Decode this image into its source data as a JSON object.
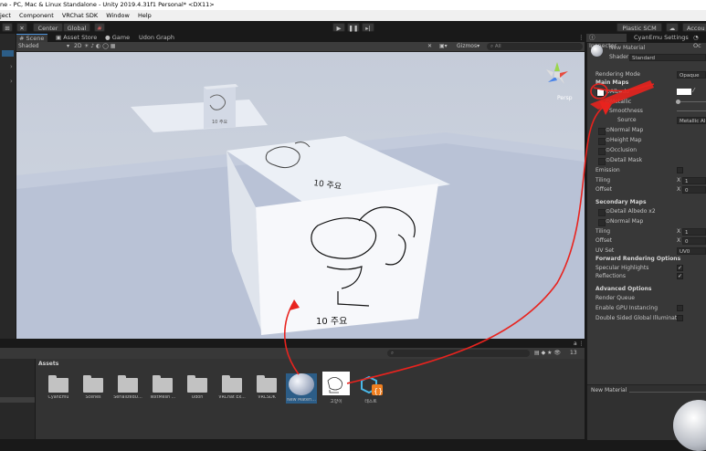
{
  "window": {
    "title": "ne - PC, Mac & Linux Standalone - Unity 2019.4.31f1 Personal* <DX11>"
  },
  "menu": [
    "ject",
    "Component",
    "VRChat SDK",
    "Window",
    "Help"
  ],
  "toolbar": {
    "center_label": "Center",
    "global_label": "Global",
    "plastic_label": "Plastic SCM",
    "account_label": "Accou"
  },
  "scene_tabs": [
    {
      "label": "Scene"
    },
    {
      "label": "Asset Store"
    },
    {
      "label": "Game"
    },
    {
      "label": "Udon Graph"
    }
  ],
  "scene_toolbar": {
    "shading_mode": "Shaded",
    "mode_2d": "2D",
    "gizmos_label": "Gizmos",
    "search_placeholder": "All",
    "persp_label": "Persp"
  },
  "viewport": {
    "small_text": "10 주요",
    "board_text": "10 주요",
    "front_text": "10 주요"
  },
  "project": {
    "assets_label": "Assets",
    "count_label": "13",
    "items": [
      {
        "label": "CyanEmu",
        "icon": "folder-icon"
      },
      {
        "label": "Scenes",
        "icon": "folder-icon"
      },
      {
        "label": "SerializedU...",
        "icon": "folder-icon"
      },
      {
        "label": "TextMesh ...",
        "icon": "folder-icon"
      },
      {
        "label": "Udon",
        "icon": "folder-icon"
      },
      {
        "label": "VRChat Ex...",
        "icon": "folder-icon"
      },
      {
        "label": "VRCSDK",
        "icon": "folder-icon"
      },
      {
        "label": "New Materi...",
        "icon": "material-sphere-icon"
      },
      {
        "label": "고양이",
        "icon": "texture-thumbnail-icon"
      },
      {
        "label": "테스트",
        "icon": "udon-script-icon"
      }
    ]
  },
  "inspector": {
    "tabs": [
      {
        "label": "Inspector"
      },
      {
        "label": "CyanEmu Settings"
      },
      {
        "label": "Oc"
      }
    ],
    "material_name": "New Material",
    "shader_label": "Shader",
    "shader_value": "Standard",
    "rendering_mode_label": "Rendering Mode",
    "rendering_mode_value": "Opaque",
    "main_maps_header": "Main Maps",
    "albedo_label": "Albedo",
    "metallic_label": "Metallic",
    "smoothness_label": "Smoothness",
    "source_label": "Source",
    "source_value": "Metallic Al",
    "normal_map_label": "Normal Map",
    "height_map_label": "Height Map",
    "occlusion_label": "Occlusion",
    "detail_mask_label": "Detail Mask",
    "emission_label": "Emission",
    "tiling_label": "Tiling",
    "offset_label": "Offset",
    "x_label": "X",
    "tiling_x": "1",
    "offset_x": "0",
    "secondary_maps_header": "Secondary Maps",
    "detail_albedo_label": "Detail Albedo x2",
    "normal_map2_label": "Normal Map",
    "tiling2_label": "Tiling",
    "offset2_label": "Offset",
    "tiling2_x": "1",
    "offset2_x": "0",
    "uv_set_label": "UV Set",
    "uv_set_value": "UV0",
    "forward_header": "Forward Rendering Options",
    "specular_label": "Specular Highlights",
    "reflections_label": "Reflections",
    "advanced_header": "Advanced Options",
    "render_queue_label": "Render Queue",
    "gpu_instancing_label": "Enable GPU Instancing",
    "double_sided_label": "Double Sided Global Illuminatio",
    "preview_label": "New Material",
    "specular_check": "✓",
    "reflections_check": "✓"
  },
  "colors": {
    "annotation": "#e8231e",
    "viewport_bg": "#c9d0de"
  }
}
